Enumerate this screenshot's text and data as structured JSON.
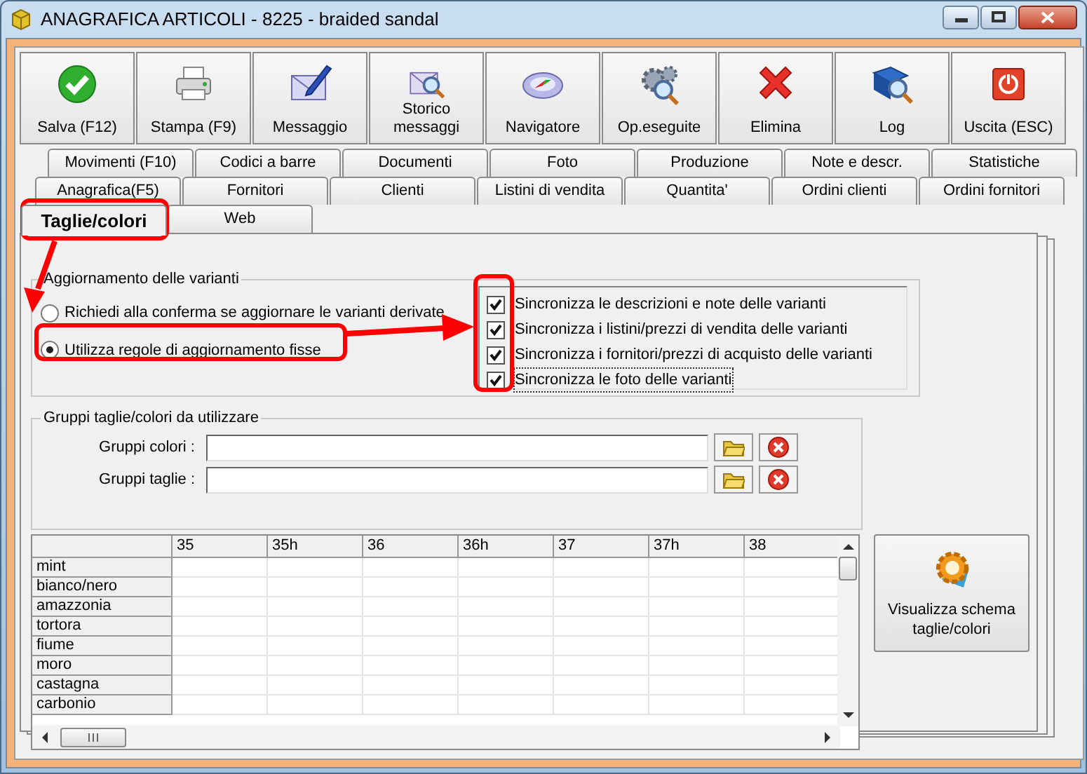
{
  "window": {
    "title": "ANAGRAFICA ARTICOLI - 8225 - braided sandal"
  },
  "toolbar": [
    {
      "label": "Salva (F12)"
    },
    {
      "label": "Stampa (F9)"
    },
    {
      "label": "Messaggio"
    },
    {
      "label": "Storico messaggi"
    },
    {
      "label": "Navigatore"
    },
    {
      "label": "Op.eseguite"
    },
    {
      "label": "Elimina"
    },
    {
      "label": "Log"
    },
    {
      "label": "Uscita (ESC)"
    }
  ],
  "tab_rows": [
    [
      {
        "label": "Movimenti (F10)",
        "selected": false
      },
      {
        "label": "Codici a barre",
        "selected": false
      },
      {
        "label": "Documenti",
        "selected": false
      },
      {
        "label": "Foto",
        "selected": false
      },
      {
        "label": "Produzione",
        "selected": false
      },
      {
        "label": "Note e descr.",
        "selected": false
      },
      {
        "label": "Statistiche",
        "selected": false
      }
    ],
    [
      {
        "label": "Anagrafica(F5)",
        "selected": false
      },
      {
        "label": "Fornitori",
        "selected": false
      },
      {
        "label": "Clienti",
        "selected": false
      },
      {
        "label": "Listini di vendita",
        "selected": false
      },
      {
        "label": "Quantita'",
        "selected": false
      },
      {
        "label": "Ordini clienti",
        "selected": false
      },
      {
        "label": "Ordini fornitori",
        "selected": false
      }
    ],
    [
      {
        "label": "Taglie/colori",
        "selected": true
      },
      {
        "label": "Web",
        "selected": false
      }
    ]
  ],
  "update_group": {
    "title": "Aggiornamento delle varianti",
    "options": [
      {
        "label": "Richiedi alla conferma se aggiornare le varianti derivate",
        "selected": false
      },
      {
        "label": "Utilizza regole di aggiornamento fisse",
        "selected": true
      }
    ],
    "sync": [
      {
        "label": "Sincronizza le descrizioni e note delle varianti",
        "checked": true,
        "focused": false
      },
      {
        "label": "Sincronizza i listini/prezzi di vendita delle varianti",
        "checked": true,
        "focused": false
      },
      {
        "label": "Sincronizza i fornitori/prezzi di acquisto delle varianti",
        "checked": true,
        "focused": false
      },
      {
        "label": "Sincronizza le foto delle varianti",
        "checked": true,
        "focused": true
      }
    ]
  },
  "groups_group": {
    "title": "Gruppi taglie/colori da utilizzare",
    "fields": [
      {
        "label": "Gruppi colori :"
      },
      {
        "label": "Gruppi taglie :"
      }
    ]
  },
  "grid": {
    "columns": [
      "35",
      "35h",
      "36",
      "36h",
      "37",
      "37h",
      "38"
    ],
    "rows": [
      "mint",
      "bianco/nero",
      "amazzonia",
      "tortora",
      "fiume",
      "moro",
      "castagna",
      "carbonio"
    ]
  },
  "schema_button": {
    "label": "Visualizza schema taglie/colori"
  }
}
